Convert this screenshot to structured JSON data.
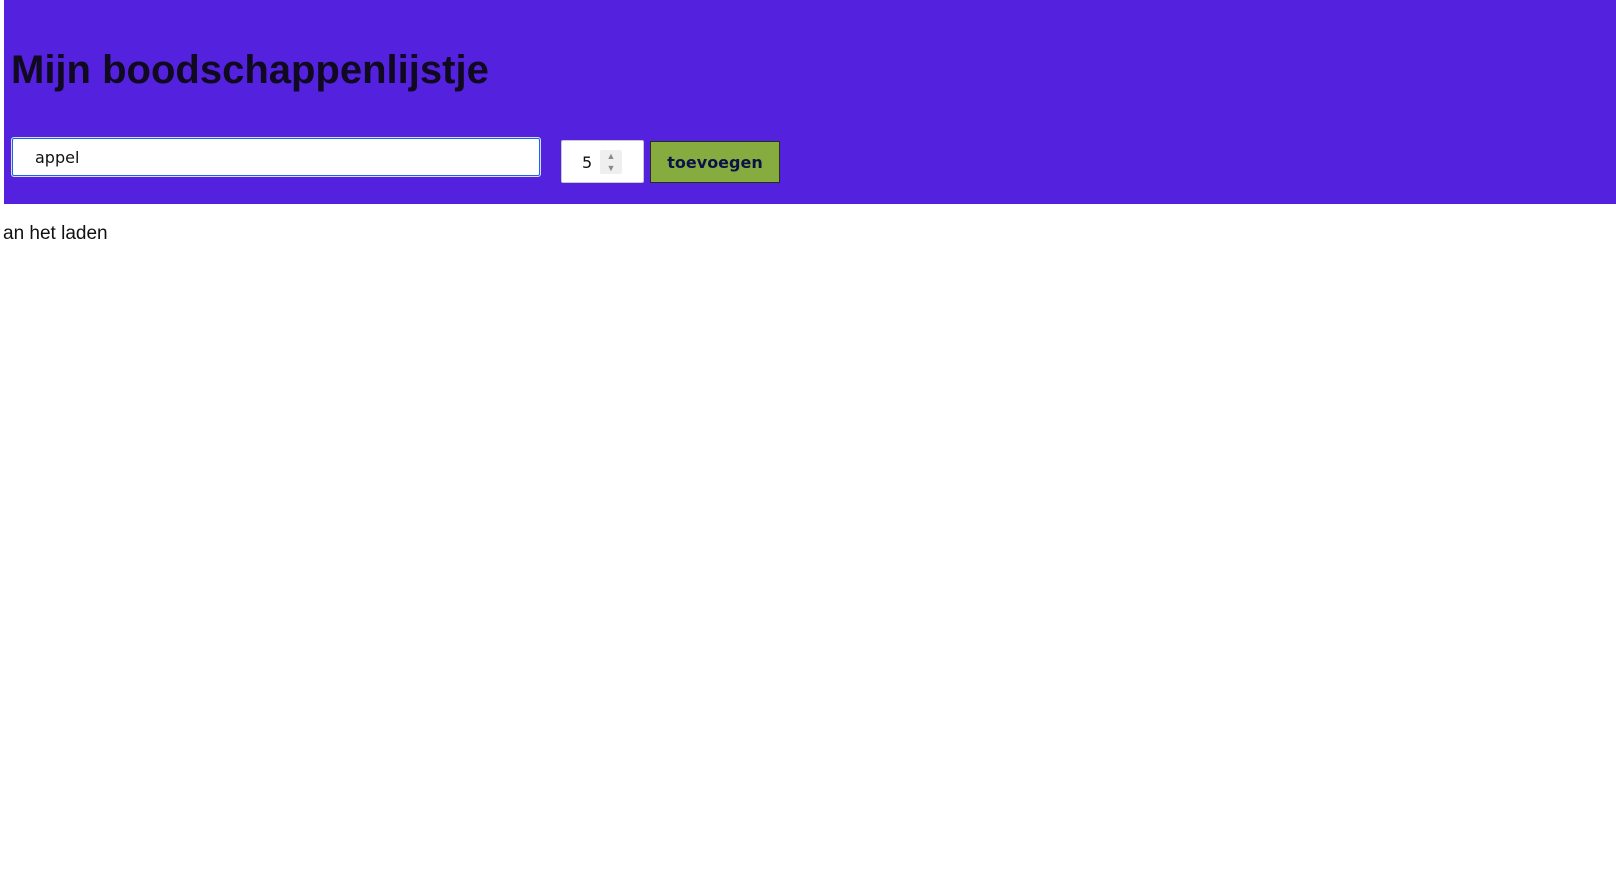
{
  "header": {
    "title": "Mijn boodschappenlijstje",
    "background_color": "#5421de"
  },
  "form": {
    "item_input_value": "appel",
    "quantity_value": "5",
    "add_button_label": "toevoegen",
    "add_button_color": "#86ac3f"
  },
  "status": {
    "text": "an het laden"
  },
  "icons": {
    "stepper_up": "chevron-up-icon",
    "stepper_down": "chevron-down-icon"
  }
}
